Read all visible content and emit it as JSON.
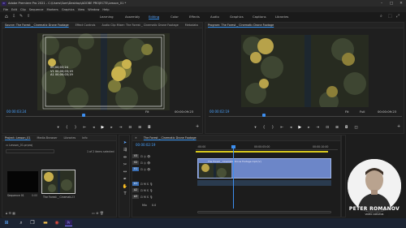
{
  "window": {
    "title": "Adobe Premiere Pro 2021 - C:\\Users\\Sam\\Desktop\\ADOBE PROJECTS\\Lesson_01 *",
    "app_icon": "Pr"
  },
  "menu": [
    "File",
    "Edit",
    "Clip",
    "Sequence",
    "Markers",
    "Graphics",
    "View",
    "Window",
    "Help"
  ],
  "workspaces": {
    "items": [
      "Learning",
      "Assembly",
      "Editing",
      "Color",
      "Effects",
      "Audio",
      "Graphics",
      "Captions",
      "Libraries"
    ],
    "active": "Editing"
  },
  "source_panel": {
    "tabs": [
      "Source: The Forest _ Cinematic Drone Footage",
      "Effect Controls",
      "Audio Clip Mixer: The Forest _ Cinematic Drone Footage",
      "Metadata"
    ],
    "overlay_lines": [
      "00;00;03;24",
      "V1 00;00;03;19",
      "A1 00;00;03;19"
    ],
    "timecode_left": "00:00:03:24",
    "fit": "Fit",
    "timecode_right": "00:00:09:23"
  },
  "program_panel": {
    "tab": "Program: The Forest _ Cinematic Drone Footage",
    "timecode_left": "00:00:02:19",
    "fit": "Fit",
    "full": "Full",
    "timecode_right": "00:00:09:23"
  },
  "project_panel": {
    "tabs": [
      "Project: Lesson_01",
      "Media Browser",
      "Libraries",
      "Info"
    ],
    "file": "Lesson_01.prproj",
    "selection": "1 of 2 items selected",
    "items": [
      {
        "name": "Sequence 01",
        "duration": "0:00"
      },
      {
        "name": "The Forest _ Cinema...",
        "duration": "9:23"
      }
    ]
  },
  "timeline_panel": {
    "tab": "The Forest _ Cinematic Drone Footage",
    "timecode": "00:00:02:19",
    "ruler": [
      ":00:00",
      "00:00:05:00",
      "00:00:10:00"
    ],
    "video_tracks": [
      "V3",
      "V2",
      "V1"
    ],
    "audio_tracks": [
      "A1",
      "A2",
      "A3"
    ],
    "clip_label": "The Forest _ Cinematic Drone Footage.mp4 [V]",
    "mix": "Mix",
    "mix_value": "0.0"
  },
  "presenter": {
    "name": "PETER ROMANOV",
    "role": "VIDEO CREATOR"
  },
  "taskbar": {
    "icons": [
      "windows-icon",
      "search-icon",
      "task-view-icon",
      "file-explorer-icon",
      "chrome-icon",
      "premiere-icon"
    ]
  },
  "colors": {
    "accent": "#2d8ceb",
    "timecode_blue": "#4aa3ff",
    "clip_blue": "#6c86c8",
    "playhead": "#3d8ff0"
  }
}
